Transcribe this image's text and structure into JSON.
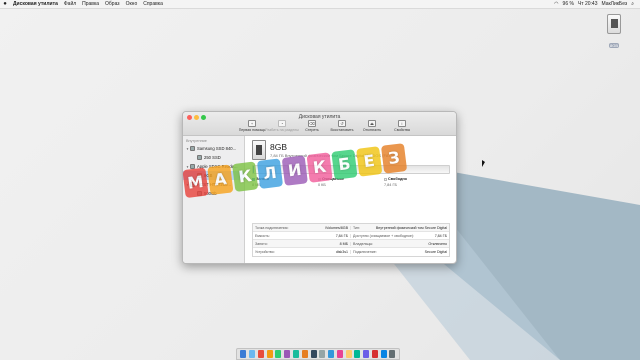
{
  "menubar": {
    "app": "Дисковая утилита",
    "items": [
      "Файл",
      "Правка",
      "Образ",
      "Окно",
      "Справка"
    ],
    "status": [
      "96 %",
      "Чт 20:43",
      "МакЛикБез"
    ]
  },
  "desktop_icon": {
    "label": "8GB"
  },
  "window": {
    "title": "Дисковая утилита",
    "toolbar": [
      {
        "label": "Первая помощь",
        "icon": "stethoscope-icon",
        "enabled": true
      },
      {
        "label": "Разбить на разделы",
        "icon": "pie-chart-icon",
        "enabled": false
      },
      {
        "label": "Стереть",
        "icon": "eraser-icon",
        "enabled": true
      },
      {
        "label": "Восстановить",
        "icon": "restore-icon",
        "enabled": true
      },
      {
        "label": "Отключить",
        "icon": "unmount-icon",
        "enabled": true
      },
      {
        "label": "Свойства",
        "icon": "info-icon",
        "enabled": true
      }
    ],
    "sidebar": {
      "header": "Внутренние",
      "items": [
        {
          "label": "Samsung SSD 840...",
          "level": 1
        },
        {
          "label": "250 SSD",
          "level": 2
        },
        {
          "label": "Apple SDXC Reade...",
          "level": 1
        },
        {
          "label": "8GB",
          "level": 2,
          "selected": true
        },
        {
          "label": "HGST HTS7210...",
          "level": 1
        },
        {
          "label": "500Gb",
          "level": 2
        }
      ]
    },
    "volume": {
      "name": "8GB",
      "subtitle": "7,84 ГБ Внутренний физический том Secure Digital MS-DOS (FAT32)",
      "used_fraction": 0.001,
      "legend": [
        {
          "label": "Занято",
          "value": "8 МБ",
          "color": "#2b8ee7"
        },
        {
          "label": "Очищаемое",
          "value": "0 КБ",
          "color": "#c9c9c9"
        },
        {
          "label": "Свободно",
          "value": "7,84 ГБ",
          "color": "#f1f1f1"
        }
      ]
    },
    "info": [
      {
        "k1": "Точка подключения:",
        "v1": "/Volumes/8GB",
        "k2": "Тип:",
        "v2": "Внутренний физический том Secure Digital"
      },
      {
        "k1": "Емкость:",
        "v1": "7,84 ГБ",
        "k2": "Доступно (очищаемое + свободное):",
        "v2": "7,84 ГБ"
      },
      {
        "k1": "Занято:",
        "v1": "8 МБ",
        "k2": "Владельцы:",
        "v2": "Отключено"
      },
      {
        "k1": "Устройство:",
        "v1": "disk3s1",
        "k2": "Подключение:",
        "v2": "Secure Digital"
      }
    ]
  },
  "watermark": {
    "letters": [
      "М",
      "А",
      "К",
      "Л",
      "И",
      "К",
      "Б",
      "Е",
      "З"
    ],
    "colors": [
      "#e8413b",
      "#f7a21b",
      "#7cc242",
      "#3aa0e0",
      "#9b59b6",
      "#f25c9a",
      "#2ecc71",
      "#f1c40f",
      "#e67e22"
    ]
  },
  "dock": {
    "colors": [
      "#3a7bd5",
      "#6bb8f0",
      "#e74c3c",
      "#f39c12",
      "#2ecc71",
      "#9b59b6",
      "#1abc9c",
      "#e67e22",
      "#34495e",
      "#95a5a6",
      "#3498db",
      "#e84393",
      "#fdcb6e",
      "#00b894",
      "#6c5ce7",
      "#d63031",
      "#0984e3",
      "#636e72"
    ]
  }
}
